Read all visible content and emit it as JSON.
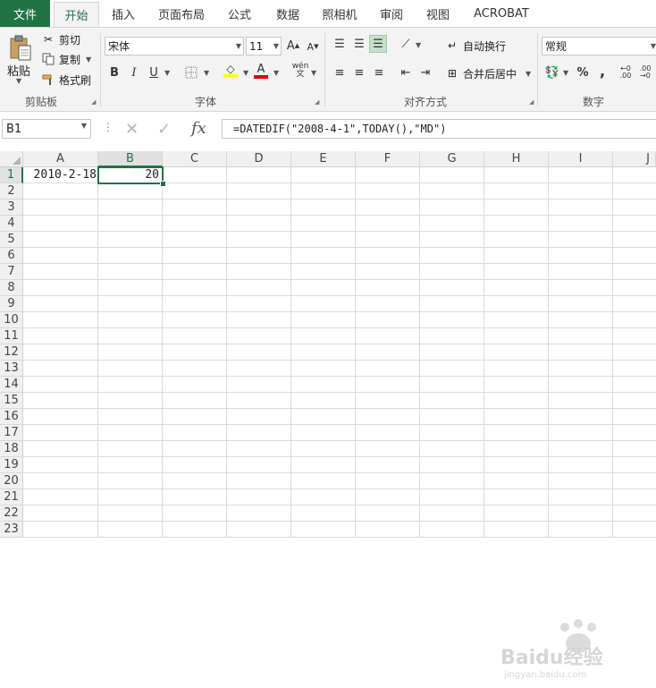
{
  "tabs": [
    {
      "label": "文件",
      "active": false
    },
    {
      "label": "开始",
      "active": true
    },
    {
      "label": "插入",
      "active": false
    },
    {
      "label": "页面布局",
      "active": false
    },
    {
      "label": "公式",
      "active": false
    },
    {
      "label": "数据",
      "active": false
    },
    {
      "label": "照相机",
      "active": false
    },
    {
      "label": "审阅",
      "active": false
    },
    {
      "label": "视图",
      "active": false
    },
    {
      "label": "ACROBAT",
      "active": false
    }
  ],
  "ribbon": {
    "clipboard": {
      "paste": "粘贴",
      "cut": "剪切",
      "copy": "复制",
      "format_painter": "格式刷",
      "group_label": "剪贴板"
    },
    "font": {
      "name": "宋体",
      "size": "11",
      "group_label": "字体",
      "bold": "B",
      "italic": "I",
      "underline": "U",
      "wen": "wén"
    },
    "alignment": {
      "wrap_text": "自动换行",
      "merge_center": "合并后居中",
      "group_label": "对齐方式"
    },
    "number": {
      "format": "常规",
      "percent": "%",
      "comma": ",",
      "group_label": "数字"
    }
  },
  "formula_bar": {
    "name_box": "B1",
    "formula": "=DATEDIF(\"2008-4-1\",TODAY(),\"MD\")",
    "fx": "fx"
  },
  "grid": {
    "columns": [
      "A",
      "B",
      "C",
      "D",
      "E",
      "F",
      "G",
      "H",
      "I",
      "J"
    ],
    "rows": [
      "1",
      "2",
      "3",
      "4",
      "5",
      "6",
      "7",
      "8",
      "9",
      "10",
      "11",
      "12",
      "13",
      "14",
      "15",
      "16",
      "17",
      "18",
      "19",
      "20",
      "21",
      "22",
      "23"
    ],
    "active_cell": "B1",
    "cells": {
      "A1": "2010-2-18",
      "B1": "20"
    }
  },
  "watermark": {
    "brand": "Baidu",
    "text": "经验",
    "url": "jingyan.baidu.com"
  },
  "colors": {
    "accent": "#217346",
    "selection": "#217346"
  }
}
